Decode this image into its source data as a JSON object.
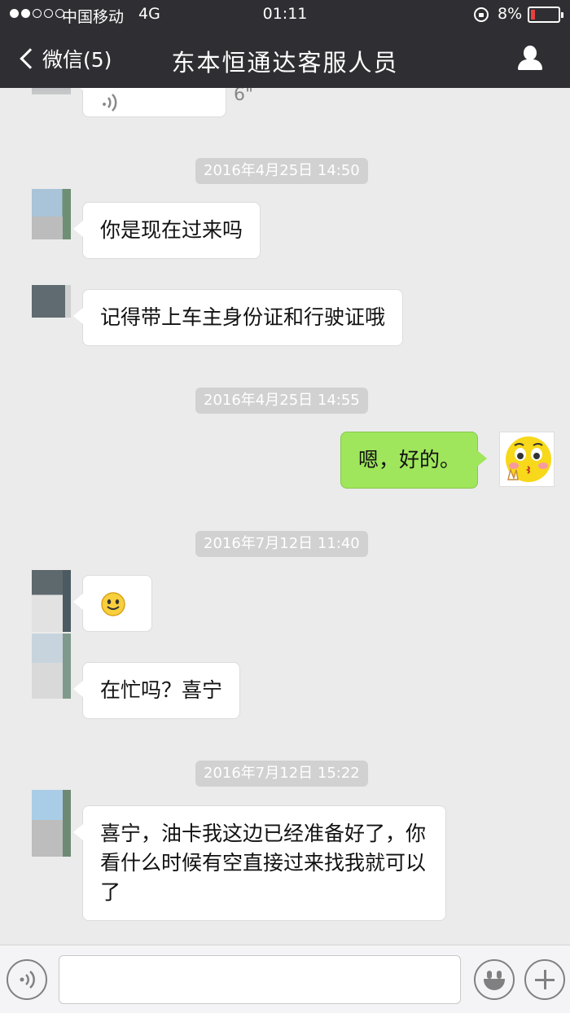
{
  "status_bar": {
    "carrier": "中国移动",
    "network": "4G",
    "time": "01:11",
    "battery_percent": "8%"
  },
  "nav": {
    "back_label": "微信(5)",
    "title": "东本恒通达客服人员"
  },
  "chat": {
    "partial_voice_duration": "6\"",
    "timestamps": [
      "2016年4月25日 14:50",
      "2016年4月25日 14:55",
      "2016年7月12日 11:40",
      "2016年7月12日 15:22"
    ],
    "messages": [
      {
        "from": "them",
        "text": "你是现在过来吗"
      },
      {
        "from": "them",
        "text": "记得带上车主身份证和行驶证哦"
      },
      {
        "from": "me",
        "text": "嗯，好的。"
      },
      {
        "from": "them",
        "text": "",
        "emoji": "smile-emoji"
      },
      {
        "from": "them",
        "text": "在忙吗？喜宁"
      },
      {
        "from": "them",
        "text": "喜宁，油卡我这边已经准备好了，你看什么时候有空直接过来找我就可以了"
      }
    ]
  },
  "input_bar": {
    "voice_icon": "voice-icon",
    "emoji_icon": "emoji-icon",
    "plus_icon": "plus-icon",
    "input_value": ""
  },
  "colors": {
    "topbar": "#2f2f33",
    "chat_background": "#ebebeb",
    "sent_bubble": "#9fe65c",
    "received_bubble": "#ffffff",
    "timestamp_chip": "#d1d1d1",
    "battery_low": "#e8413e"
  }
}
